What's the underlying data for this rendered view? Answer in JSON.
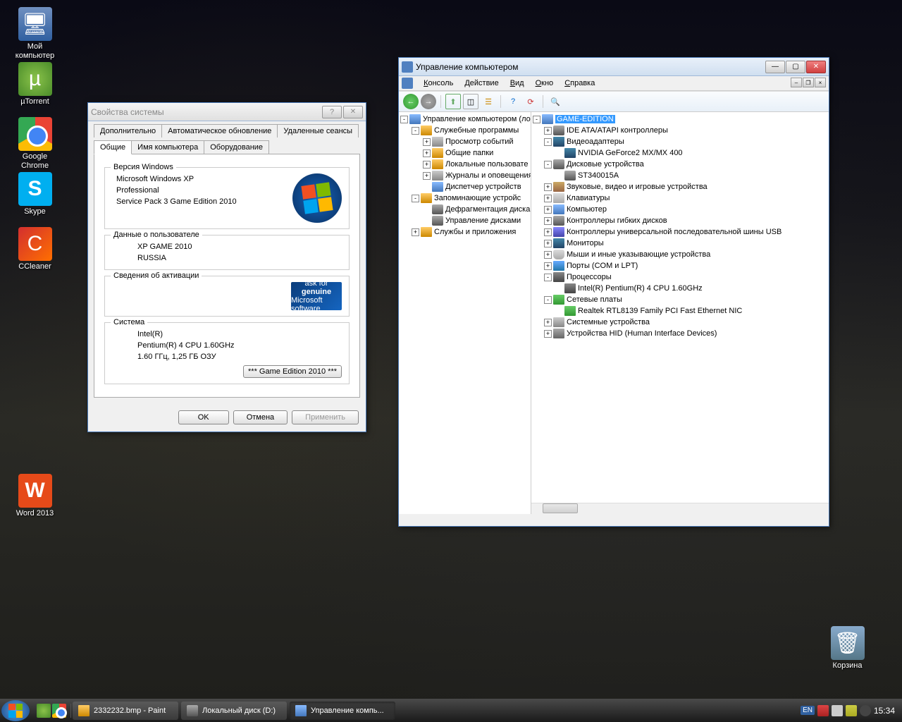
{
  "desktop_icons": [
    {
      "name": "my-computer",
      "label": "Мой\nкомпьютер",
      "cls": "ico-computer",
      "glyph": "🖥"
    },
    {
      "name": "utorrent",
      "label": "µTorrent",
      "cls": "ico-utorrent",
      "glyph": "µ"
    },
    {
      "name": "google-chrome",
      "label": "Google\nChrome",
      "cls": "ico-chrome",
      "glyph": ""
    },
    {
      "name": "skype",
      "label": "Skype",
      "cls": "ico-skype",
      "glyph": "S"
    },
    {
      "name": "ccleaner",
      "label": "CCleaner",
      "cls": "ico-ccleaner",
      "glyph": "C"
    },
    {
      "name": "word2013",
      "label": "Word 2013",
      "cls": "ico-word",
      "glyph": "W"
    }
  ],
  "recycle": {
    "label": "Корзина"
  },
  "sysprops": {
    "title": "Свойства системы",
    "tabs_row1": [
      "Дополнительно",
      "Автоматическое обновление",
      "Удаленные сеансы"
    ],
    "tabs_row2": [
      "Общие",
      "Имя компьютера",
      "Оборудование"
    ],
    "active_tab": "Общие",
    "groups": {
      "version_legend": "Версия Windows",
      "version_lines": [
        "Microsoft Windows XP",
        "Professional",
        "Service Pack 3 Game Edition 2010"
      ],
      "user_legend": "Данные о пользователе",
      "user_lines": [
        "XP GAME 2010",
        "RUSSIA"
      ],
      "activation_legend": "Сведения об активации",
      "genuine_top": "ask for",
      "genuine_mid": "genuine",
      "genuine_bot": "Microsoft software",
      "system_legend": "Система",
      "system_lines": [
        "Intel(R)",
        "Pentium(R) 4 CPU 1.60GHz",
        "1.60 ГГц, 1,25 ГБ ОЗУ"
      ],
      "edition_btn": "*** Game Edition 2010 ***"
    },
    "buttons": {
      "ok": "OK",
      "cancel": "Отмена",
      "apply": "Применить"
    }
  },
  "mgmt": {
    "title": "Управление компьютером",
    "menu": [
      "Консоль",
      "Действие",
      "Вид",
      "Окно",
      "Справка"
    ],
    "left_tree": [
      {
        "indent": 0,
        "expand": "-",
        "icon": "ico-comp",
        "label": "Управление компьютером (ло"
      },
      {
        "indent": 1,
        "expand": "-",
        "icon": "ico-folder",
        "label": "Служебные программы"
      },
      {
        "indent": 2,
        "expand": "+",
        "icon": "ico-dev",
        "label": "Просмотр событий"
      },
      {
        "indent": 2,
        "expand": "+",
        "icon": "ico-folder",
        "label": "Общие папки"
      },
      {
        "indent": 2,
        "expand": "+",
        "icon": "ico-folder",
        "label": "Локальные пользовате"
      },
      {
        "indent": 2,
        "expand": "+",
        "icon": "ico-dev",
        "label": "Журналы и оповещения"
      },
      {
        "indent": 2,
        "expand": " ",
        "icon": "ico-comp",
        "label": "Диспетчер устройств"
      },
      {
        "indent": 1,
        "expand": "-",
        "icon": "ico-folder",
        "label": "Запоминающие устройс"
      },
      {
        "indent": 2,
        "expand": " ",
        "icon": "ico-disk",
        "label": "Дефрагментация диска"
      },
      {
        "indent": 2,
        "expand": " ",
        "icon": "ico-disk",
        "label": "Управление дисками"
      },
      {
        "indent": 1,
        "expand": "+",
        "icon": "ico-folder",
        "label": "Службы и приложения"
      }
    ],
    "right_tree": [
      {
        "indent": 0,
        "expand": "-",
        "icon": "ico-comp",
        "label": "GAME-EDITION",
        "sel": true
      },
      {
        "indent": 1,
        "expand": "+",
        "icon": "ico-disk",
        "label": "IDE ATA/ATAPI контроллеры"
      },
      {
        "indent": 1,
        "expand": "-",
        "icon": "ico-mon",
        "label": "Видеоадаптеры"
      },
      {
        "indent": 2,
        "expand": " ",
        "icon": "ico-mon",
        "label": "NVIDIA GeForce2 MX/MX 400"
      },
      {
        "indent": 1,
        "expand": "-",
        "icon": "ico-disk",
        "label": "Дисковые устройства"
      },
      {
        "indent": 2,
        "expand": " ",
        "icon": "ico-disk",
        "label": "ST340015A"
      },
      {
        "indent": 1,
        "expand": "+",
        "icon": "ico-snd",
        "label": "Звуковые, видео и игровые устройства"
      },
      {
        "indent": 1,
        "expand": "+",
        "icon": "ico-kbd",
        "label": "Клавиатуры"
      },
      {
        "indent": 1,
        "expand": "+",
        "icon": "ico-comp",
        "label": "Компьютер"
      },
      {
        "indent": 1,
        "expand": "+",
        "icon": "ico-disk",
        "label": "Контроллеры гибких дисков"
      },
      {
        "indent": 1,
        "expand": "+",
        "icon": "ico-usb",
        "label": "Контроллеры универсальной последовательной шины USB"
      },
      {
        "indent": 1,
        "expand": "+",
        "icon": "ico-mon",
        "label": "Мониторы"
      },
      {
        "indent": 1,
        "expand": "+",
        "icon": "ico-mouse",
        "label": "Мыши и иные указывающие устройства"
      },
      {
        "indent": 1,
        "expand": "+",
        "icon": "ico-port",
        "label": "Порты (COM и LPT)"
      },
      {
        "indent": 1,
        "expand": "-",
        "icon": "ico-cpu",
        "label": "Процессоры"
      },
      {
        "indent": 2,
        "expand": " ",
        "icon": "ico-cpu",
        "label": "Intel(R) Pentium(R) 4 CPU 1.60GHz"
      },
      {
        "indent": 1,
        "expand": "-",
        "icon": "ico-net",
        "label": "Сетевые платы"
      },
      {
        "indent": 2,
        "expand": " ",
        "icon": "ico-net",
        "label": "Realtek RTL8139 Family PCI Fast Ethernet NIC"
      },
      {
        "indent": 1,
        "expand": "+",
        "icon": "ico-dev",
        "label": "Системные устройства"
      },
      {
        "indent": 1,
        "expand": "+",
        "icon": "ico-hid",
        "label": "Устройства HID (Human Interface Devices)"
      }
    ]
  },
  "taskbar": {
    "tasks": [
      {
        "name": "paint",
        "label": "2332232.bmp - Paint",
        "icon": "ico-folder"
      },
      {
        "name": "localdisk",
        "label": "Локальный диск (D:)",
        "icon": "ico-disk"
      },
      {
        "name": "compmgmt",
        "label": "Управление компь...",
        "icon": "ico-comp",
        "active": true
      }
    ],
    "lang": "EN",
    "clock": "15:34"
  }
}
